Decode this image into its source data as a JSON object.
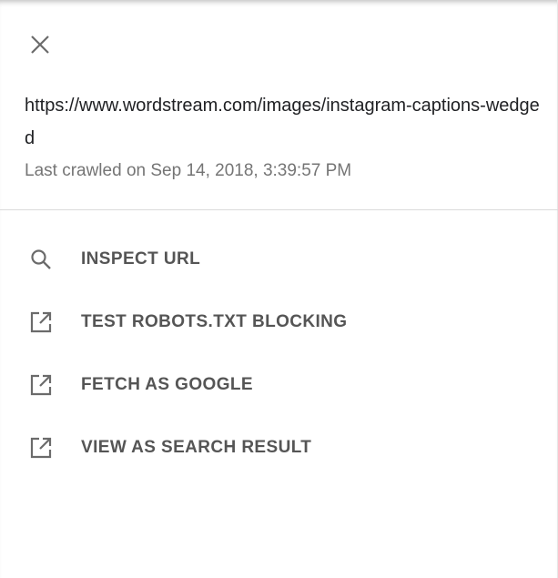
{
  "panel": {
    "url": "https://www.wordstream.com/images/instagram-captions-wedged",
    "crawled": "Last crawled on Sep 14, 2018, 3:39:57 PM"
  },
  "menu": {
    "items": [
      {
        "label": "INSPECT URL",
        "icon": "search-icon"
      },
      {
        "label": "TEST ROBOTS.TXT BLOCKING",
        "icon": "open-in-new-icon"
      },
      {
        "label": "FETCH AS GOOGLE",
        "icon": "open-in-new-icon"
      },
      {
        "label": "VIEW AS SEARCH RESULT",
        "icon": "open-in-new-icon"
      }
    ]
  }
}
